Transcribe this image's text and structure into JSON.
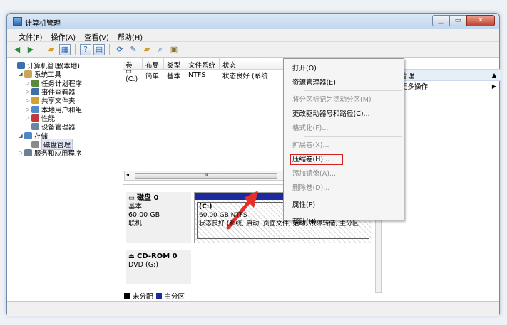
{
  "window": {
    "title": "计算机管理"
  },
  "menu": [
    "文件(F)",
    "操作(A)",
    "查看(V)",
    "帮助(H)"
  ],
  "toolbar": {
    "icons": [
      "back-icon",
      "forward-icon",
      "up-folder-icon",
      "show-tree-icon",
      "help-icon",
      "properties-icon",
      "refresh-icon",
      "connect-icon",
      "open-icon",
      "search-icon",
      "export-icon"
    ]
  },
  "tree": [
    {
      "label": "计算机管理(本地)",
      "level": 0,
      "expand": "",
      "icon": "#3a6fb2"
    },
    {
      "label": "系统工具",
      "level": 1,
      "expand": "◢",
      "icon": "#c9a45a"
    },
    {
      "label": "任务计划程序",
      "level": 2,
      "expand": "▷",
      "icon": "#5c8a3b"
    },
    {
      "label": "事件查看器",
      "level": 2,
      "expand": "▷",
      "icon": "#3e6fa8"
    },
    {
      "label": "共享文件夹",
      "level": 2,
      "expand": "▷",
      "icon": "#d6a02e"
    },
    {
      "label": "本地用户和组",
      "level": 2,
      "expand": "▷",
      "icon": "#4d8bc9"
    },
    {
      "label": "性能",
      "level": 2,
      "expand": "▷",
      "icon": "#c23a3a"
    },
    {
      "label": "设备管理器",
      "level": 2,
      "expand": "",
      "icon": "#6b86a6"
    },
    {
      "label": "存储",
      "level": 1,
      "expand": "◢",
      "icon": "#4f86c6"
    },
    {
      "label": "磁盘管理",
      "level": 2,
      "expand": "",
      "icon": "#8a8a8a",
      "selected": true
    },
    {
      "label": "服务和应用程序",
      "level": 1,
      "expand": "▷",
      "icon": "#6b7f95"
    }
  ],
  "volume_table": {
    "headers": [
      "卷",
      "布局",
      "类型",
      "文件系统",
      "状态"
    ],
    "rows": [
      {
        "vol": "(C:)",
        "layout": "简单",
        "type": "基本",
        "fs": "NTFS",
        "status": "状态良好 (系统"
      }
    ]
  },
  "scroll_glyph": "III",
  "disk0": {
    "name": "磁盘 0",
    "type": "基本",
    "size": "60.00 GB",
    "state": "联机",
    "part_name": "(C:)",
    "part_size": "60.00 GB NTFS",
    "part_status": "状态良好 (系统, 启动, 页面文件, 活动, 故障转储, 主分区"
  },
  "cdrom": {
    "name": "CD-ROM 0",
    "drive": "DVD (G:)"
  },
  "legend": [
    {
      "label": "未分配",
      "color": "#000000"
    },
    {
      "label": "主分区",
      "color": "#1b2a9c"
    }
  ],
  "actions": {
    "section": "管理",
    "more": "更多操作"
  },
  "context_menu": {
    "items": [
      {
        "label": "打开(O)",
        "disabled": false
      },
      {
        "label": "资源管理器(E)",
        "disabled": false,
        "sep_after": true
      },
      {
        "label": "将分区标记为活动分区(M)",
        "disabled": true
      },
      {
        "label": "更改驱动器号和路径(C)...",
        "disabled": false
      },
      {
        "label": "格式化(F)...",
        "disabled": true,
        "sep_after": true
      },
      {
        "label": "扩展卷(X)...",
        "disabled": true
      },
      {
        "label": "压缩卷(H)...",
        "disabled": false,
        "highlighted": true
      },
      {
        "label": "添加镜像(A)...",
        "disabled": true
      },
      {
        "label": "删除卷(D)...",
        "disabled": true,
        "sep_after": true
      },
      {
        "label": "属性(P)",
        "disabled": false,
        "sep_after": true
      },
      {
        "label": "帮助(H)",
        "disabled": false
      }
    ]
  },
  "colors": {
    "primary_partition": "#1b2a9c",
    "highlight_box": "#d02020",
    "annotation_arrow": "#e5302a"
  }
}
